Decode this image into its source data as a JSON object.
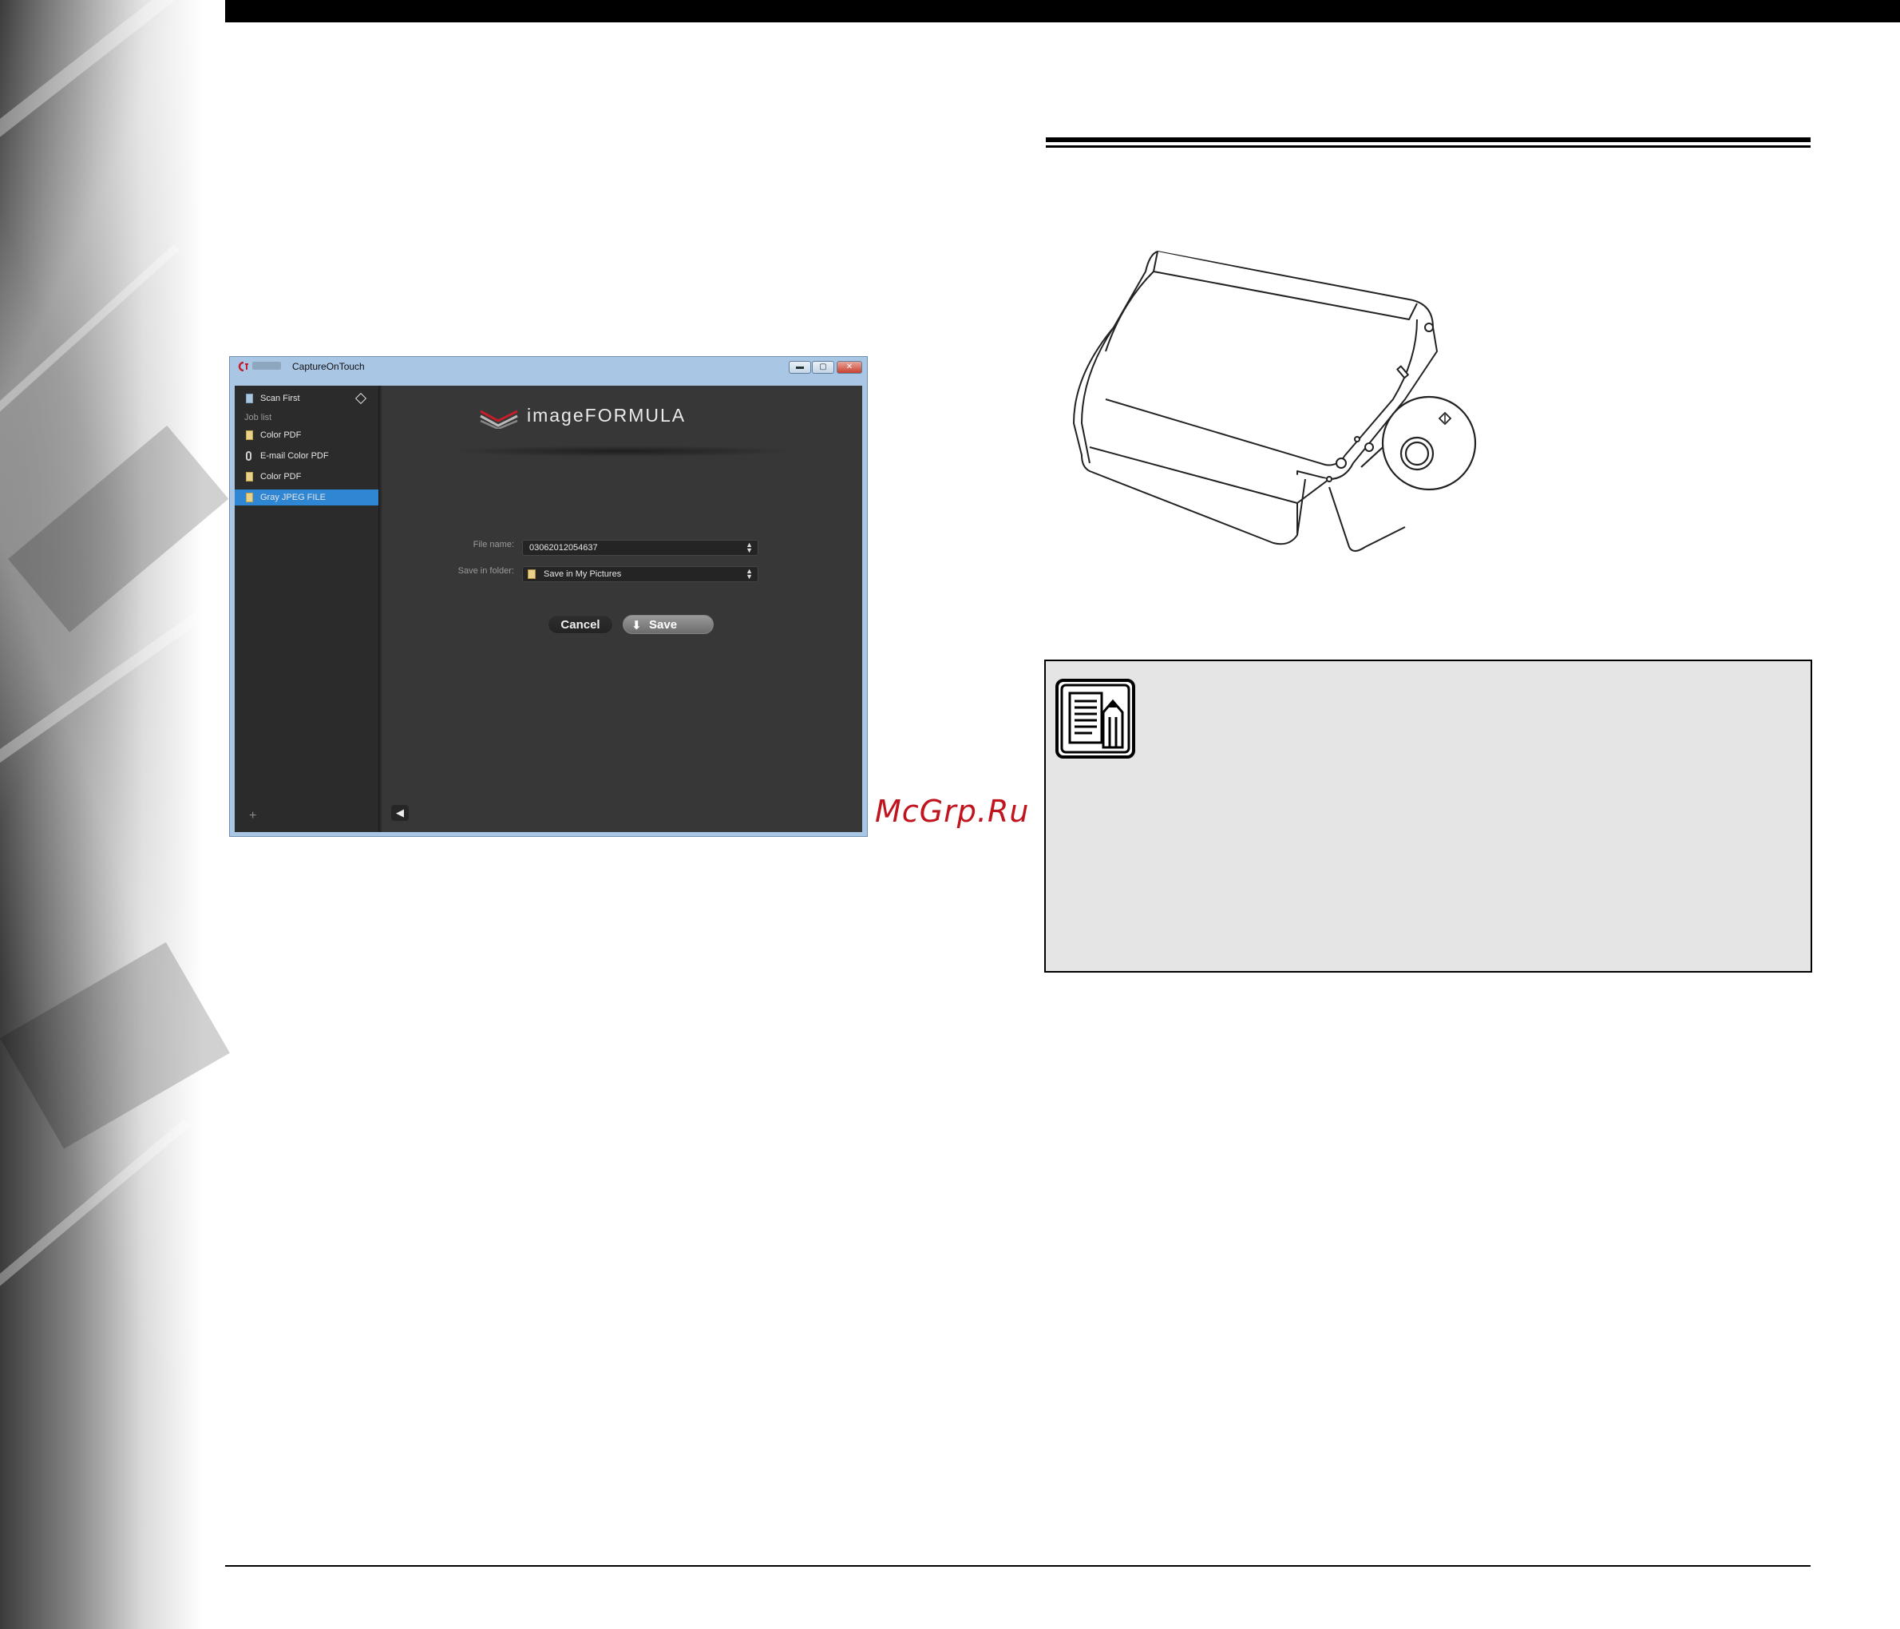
{
  "app": {
    "title": "CaptureOnTouch",
    "window_controls": {
      "minimize": "▬",
      "maximize": "▢",
      "close": "✕"
    },
    "sidebar": {
      "scan_first": "Scan First",
      "job_list_label": "Job list",
      "jobs": [
        {
          "label": "Color PDF",
          "icon": "pdf-file-icon"
        },
        {
          "label": "E-mail Color PDF",
          "icon": "paperclip-icon"
        },
        {
          "label": "Color PDF",
          "icon": "pdf-file-icon"
        },
        {
          "label": "Gray JPEG FILE",
          "icon": "jpeg-file-icon",
          "selected": true
        }
      ],
      "add_button": "+"
    },
    "brand": "imageFORMULA",
    "form": {
      "file_name_label": "File name:",
      "file_name_value": "03062012054637",
      "save_in_folder_label": "Save in folder:",
      "save_in_folder_value": "Save in My Pictures"
    },
    "buttons": {
      "cancel": "Cancel",
      "save": "Save",
      "back": "◀"
    },
    "accent_color": "#2f86d3"
  },
  "watermark": "McGrp.Ru",
  "icons": {
    "note_icon": "note-pencil-icon",
    "start_button_symbol": "start-button-icon"
  }
}
